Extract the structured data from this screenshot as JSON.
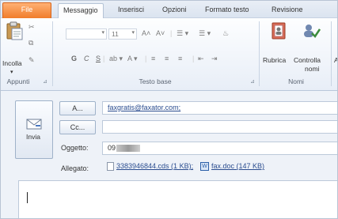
{
  "tabs": [
    {
      "id": "file",
      "label": "File"
    },
    {
      "id": "messaggio",
      "label": "Messaggio"
    },
    {
      "id": "inserisci",
      "label": "Inserisci"
    },
    {
      "id": "opzioni",
      "label": "Opzioni"
    },
    {
      "id": "formato",
      "label": "Formato testo"
    },
    {
      "id": "revisione",
      "label": "Revisione"
    }
  ],
  "ribbon": {
    "clipboard": {
      "paste_label": "Incolla",
      "group_label": "Appunti"
    },
    "font": {
      "size_value": "11",
      "group_label": "Testo base",
      "bold": "G",
      "italic": "C",
      "underline": "S"
    },
    "names": {
      "rubrica_label": "Rubrica",
      "controlla_label_1": "Controlla",
      "controlla_label_2": "nomi",
      "group_label": "Nomi",
      "overflow_label": "A"
    }
  },
  "compose": {
    "send_label": "Invia",
    "to_button": "A...",
    "to_value": "faxgratis@faxator.com;",
    "cc_button": "Cc...",
    "cc_value": "",
    "subject_label": "Oggetto:",
    "subject_value": "09",
    "attachment_label": "Allegato:",
    "attachments": [
      {
        "name": "3383946844.cds (1 KB);"
      },
      {
        "name": "fax.doc (147 KB)"
      }
    ],
    "body_value": ""
  },
  "colors": {
    "file_tab": "#f07d2a",
    "link": "#2a4c8f",
    "accent_border": "#9fb2c9"
  }
}
